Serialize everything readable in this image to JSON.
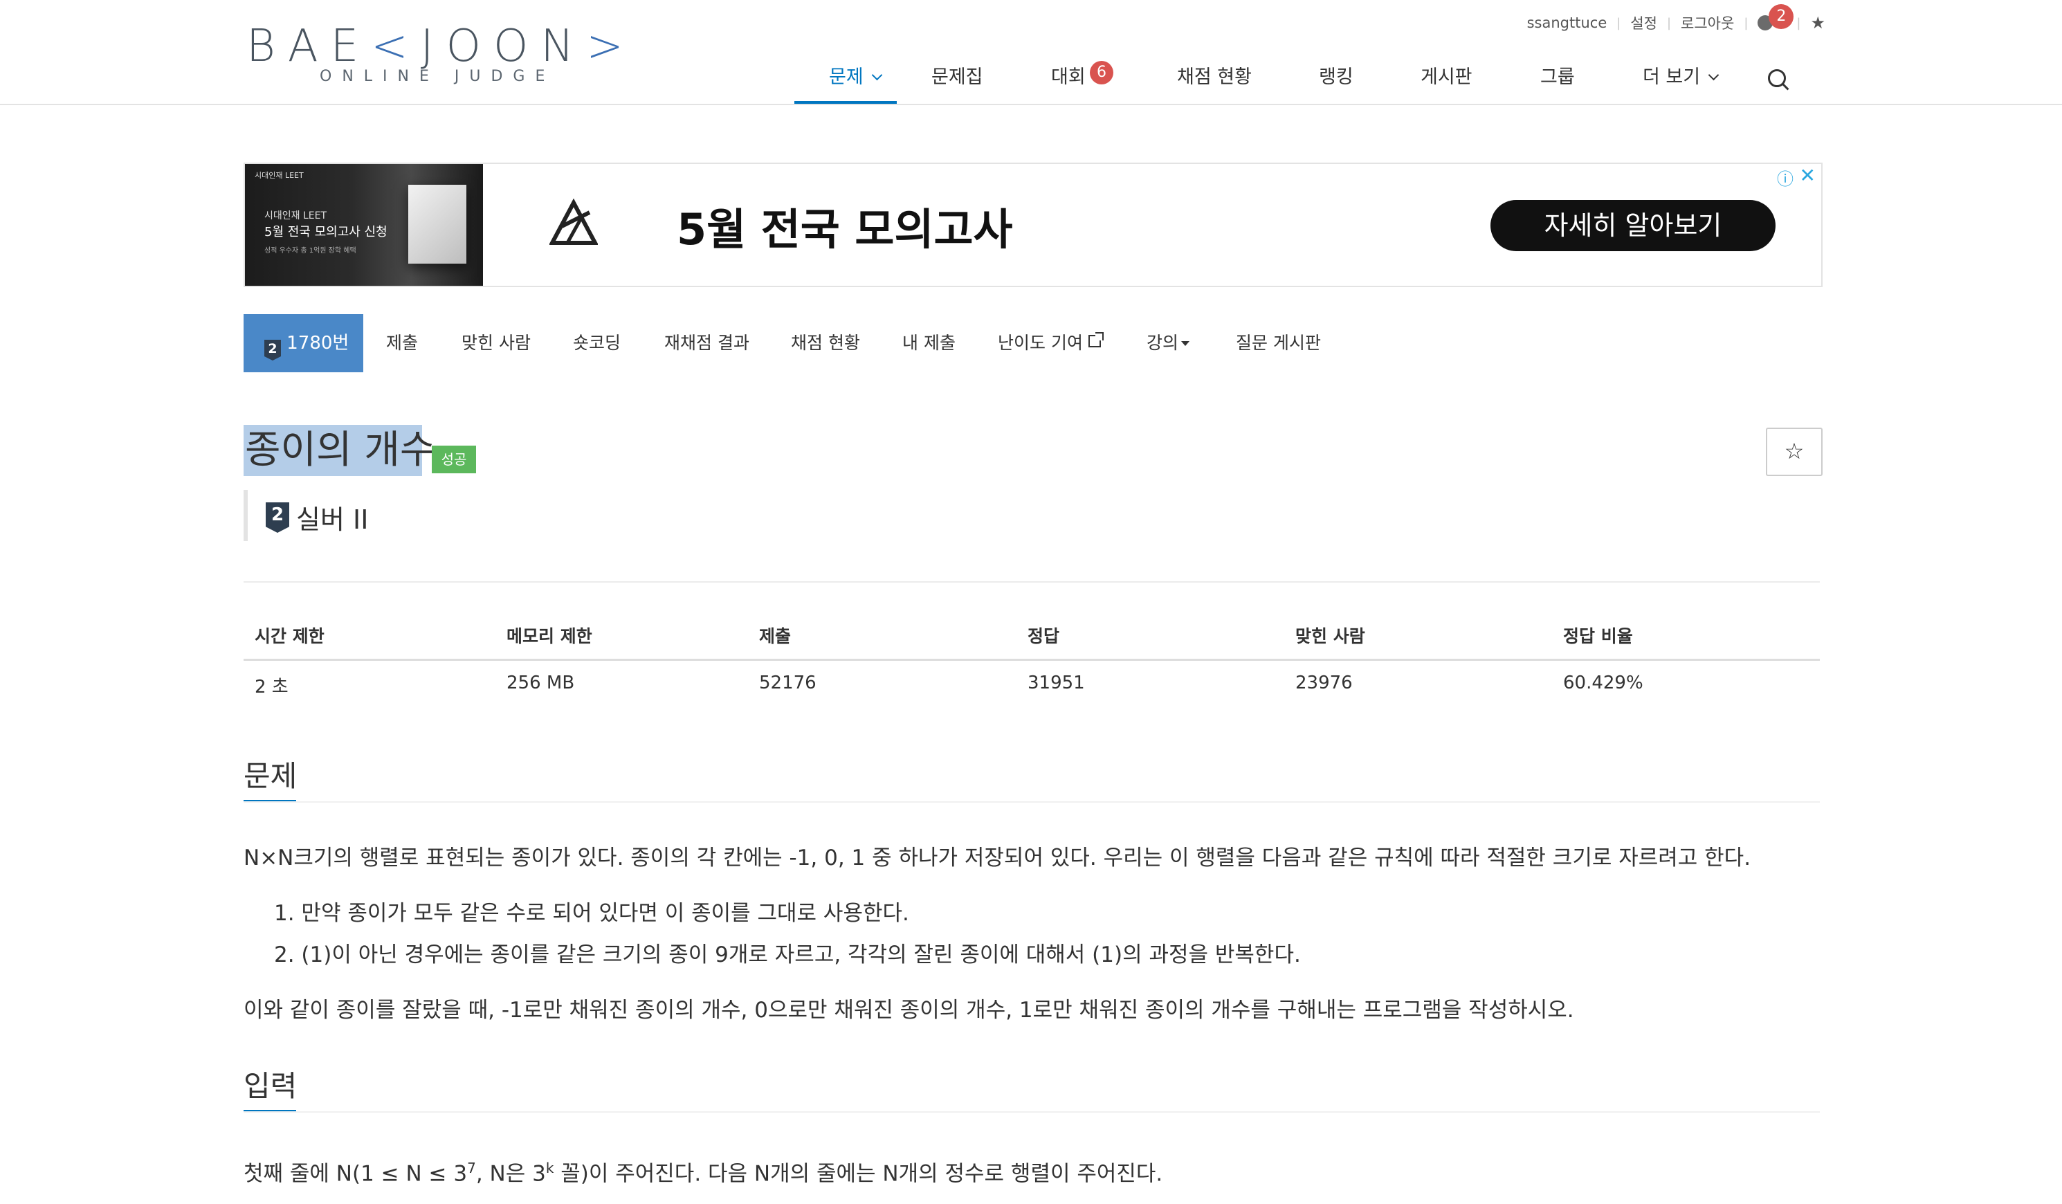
{
  "header": {
    "logo_main_left": "BAE",
    "logo_main_bracket": "<",
    "logo_main_mid": "JOON",
    "logo_main_bracket2": ">",
    "logo_sub": "ONLINE JUDGE",
    "topbar": {
      "username": "ssangttuce",
      "settings": "설정",
      "logout": "로그아웃",
      "notification_count": "2",
      "star": "★"
    },
    "nav": [
      {
        "label": "문제"
      },
      {
        "label": "문제집"
      },
      {
        "label": "대회"
      },
      {
        "label": "채점 현황"
      },
      {
        "label": "랭킹"
      },
      {
        "label": "게시판"
      },
      {
        "label": "그룹"
      },
      {
        "label": "더 보기"
      }
    ],
    "contest_badge": "6"
  },
  "ad": {
    "thumb_brand": "시대인재 LEET",
    "thumb_line1": "시대인재 LEET",
    "thumb_line2": "5월 전국 모의고사 신청",
    "thumb_line3": "성적 우수자 총 1억원 장학 혜택",
    "title": "5월 전국 모의고사",
    "button": "자세히 알아보기",
    "info": "ⓘ",
    "close": "✕"
  },
  "problem_menu": {
    "tier_number": "2",
    "active": "1780번",
    "items": [
      "제출",
      "맞힌 사람",
      "숏코딩",
      "재채점 결과",
      "채점 현황",
      "내 제출",
      "난이도 기여",
      "강의",
      "질문 게시판"
    ]
  },
  "problem": {
    "title": "종이의 개수",
    "status_label": "성공",
    "star": "☆",
    "tier_number": "2",
    "tier_name": "실버 II"
  },
  "stats": {
    "headers": [
      "시간 제한",
      "메모리 제한",
      "제출",
      "정답",
      "맞힌 사람",
      "정답 비율"
    ],
    "values": [
      "2 초",
      "256 MB",
      "52176",
      "31951",
      "23976",
      "60.429%"
    ]
  },
  "sections": {
    "problem_title": "문제",
    "problem_para": "N×N크기의 행렬로 표현되는 종이가 있다. 종이의 각 칸에는 -1, 0, 1 중 하나가 저장되어 있다. 우리는 이 행렬을 다음과 같은 규칙에 따라 적절한 크기로 자르려고 한다.",
    "rules": [
      "1. 만약 종이가 모두 같은 수로 되어 있다면 이 종이를 그대로 사용한다.",
      "2. (1)이 아닌 경우에는 종이를 같은 크기의 종이 9개로 자르고, 각각의 잘린 종이에 대해서 (1)의 과정을 반복한다."
    ],
    "problem_para2": "이와 같이 종이를 잘랐을 때, -1로만 채워진 종이의 개수, 0으로만 채워진 종이의 개수, 1로만 채워진 종이의 개수를 구해내는 프로그램을 작성하시오.",
    "input_title": "입력",
    "input_part1": "첫째 줄에 N(1 ≤ N ≤ 3",
    "input_sup1": "7",
    "input_part2": ", N은 3",
    "input_sup2": "k",
    "input_part3": " 꼴)이 주어진다. 다음 N개의 줄에는 N개의 정수로 행렬이 주어진다."
  },
  "colors": {
    "accent": "#0076c0",
    "active_tab": "#4a88c8",
    "success": "#5cb85c",
    "badge": "#d9534f",
    "title_highlight": "#b4cde8"
  }
}
